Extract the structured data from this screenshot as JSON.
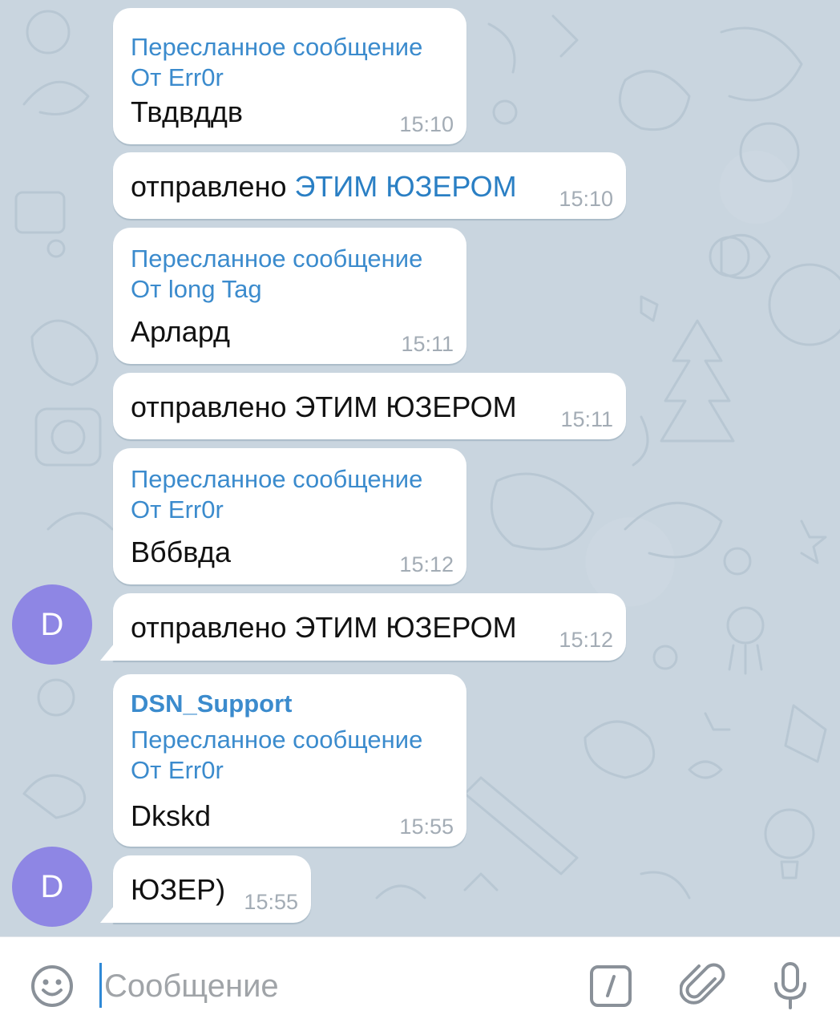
{
  "chat": {
    "messages": [
      {
        "forward_label": "Пересланное сообщение",
        "forward_from": "От Err0r",
        "text": "Твдвддв",
        "time": "15:10"
      },
      {
        "text_prefix": "отправлено ",
        "text_mention": "ЭТИМ ЮЗЕРОМ",
        "time": "15:10"
      },
      {
        "forward_label": "Пересланное сообщение",
        "forward_from": "От long Tag",
        "text": "Арлард",
        "time": "15:11"
      },
      {
        "text": "отправлено ЭТИМ ЮЗЕРОМ",
        "time": "15:11"
      },
      {
        "forward_label": "Пересланное сообщение",
        "forward_from": "От Err0r",
        "text": "Вббвда",
        "time": "15:12"
      },
      {
        "text": "отправлено ЭТИМ ЮЗЕРОМ",
        "time": "15:12",
        "avatar": "D"
      },
      {
        "sender": "DSN_Support",
        "forward_label": "Пересланное сообщение",
        "forward_from": "От Err0r",
        "text": "Dkskd",
        "time": "15:55"
      },
      {
        "text": "ЮЗЕР)",
        "time": "15:55",
        "avatar": "D"
      }
    ]
  },
  "input": {
    "placeholder": "Сообщение",
    "icons": [
      "smile-icon",
      "bot-command-icon",
      "attach-icon",
      "microphone-icon"
    ]
  },
  "colors": {
    "background": "#c9d5df",
    "link": "#3b8bcd",
    "avatar": "#8e86e4",
    "time": "#a3acb5"
  }
}
